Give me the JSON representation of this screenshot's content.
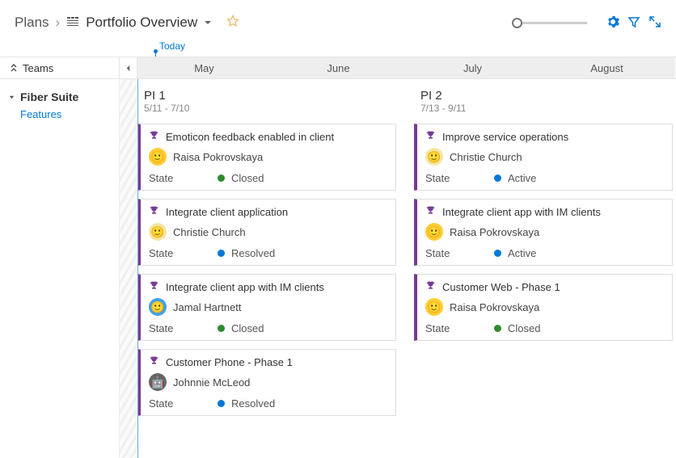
{
  "breadcrumb": {
    "root": "Plans",
    "title": "Portfolio Overview"
  },
  "today_label": "Today",
  "months": [
    "May",
    "June",
    "July",
    "August"
  ],
  "teams_header": "Teams",
  "sidebar": {
    "team": "Fiber Suite",
    "features": "Features"
  },
  "iterations": [
    {
      "title": "PI 1",
      "range": "5/11 - 7/10",
      "cards": [
        {
          "title": "Emoticon feedback enabled in client",
          "assignee": "Raisa Pokrovskaya",
          "avatar_bg": "#ffcc33",
          "avatar_glyph": "🙂",
          "state": "Closed",
          "state_class": "dot-closed"
        },
        {
          "title": "Integrate client application",
          "assignee": "Christie Church",
          "avatar_bg": "#f5e6a0",
          "avatar_glyph": "🙂",
          "state": "Resolved",
          "state_class": "dot-resolved"
        },
        {
          "title": "Integrate client app with IM clients",
          "assignee": "Jamal Hartnett",
          "avatar_bg": "#3ea2e5",
          "avatar_glyph": "🙂",
          "state": "Closed",
          "state_class": "dot-closed"
        },
        {
          "title": "Customer Phone - Phase 1",
          "assignee": "Johnnie McLeod",
          "avatar_bg": "#666",
          "avatar_glyph": "🤖",
          "state": "Resolved",
          "state_class": "dot-resolved"
        }
      ]
    },
    {
      "title": "PI 2",
      "range": "7/13 - 9/11",
      "cards": [
        {
          "title": "Improve service operations",
          "assignee": "Christie Church",
          "avatar_bg": "#f5e6a0",
          "avatar_glyph": "🙂",
          "state": "Active",
          "state_class": "dot-active"
        },
        {
          "title": "Integrate client app with IM clients",
          "assignee": "Raisa Pokrovskaya",
          "avatar_bg": "#ffcc33",
          "avatar_glyph": "🙂",
          "state": "Active",
          "state_class": "dot-active"
        },
        {
          "title": "Customer Web - Phase 1",
          "assignee": "Raisa Pokrovskaya",
          "avatar_bg": "#ffcc33",
          "avatar_glyph": "🙂",
          "state": "Closed",
          "state_class": "dot-closed"
        }
      ]
    }
  ],
  "state_label": "State"
}
